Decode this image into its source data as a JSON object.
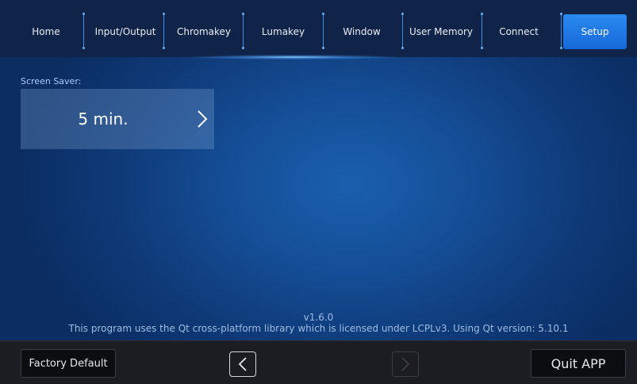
{
  "nav": {
    "tabs": [
      {
        "label": "Home"
      },
      {
        "label": "Input/Output"
      },
      {
        "label": "Chromakey"
      },
      {
        "label": "Lumakey"
      },
      {
        "label": "Window"
      },
      {
        "label": "User Memory"
      },
      {
        "label": "Connect"
      },
      {
        "label": "Setup",
        "active": true
      }
    ]
  },
  "setup": {
    "screen_saver_label": "Screen Saver:",
    "screen_saver_value": "5 min."
  },
  "footer": {
    "version": "v1.6.0",
    "license": "This program uses the Qt cross-platform library which is licensed under LCPLv3. Using Qt version: 5.10.1"
  },
  "bottom": {
    "factory_default_label": "Factory Default",
    "quit_label": "Quit APP",
    "prev_enabled": true,
    "next_enabled": false
  },
  "colors": {
    "active_tab": "#1f78e8",
    "background": "#154f98",
    "bottom_bar": "#1b1d22"
  },
  "icons": {
    "selector_arrow": "chevron-right-icon",
    "prev": "chevron-left-icon",
    "next": "chevron-right-icon"
  }
}
